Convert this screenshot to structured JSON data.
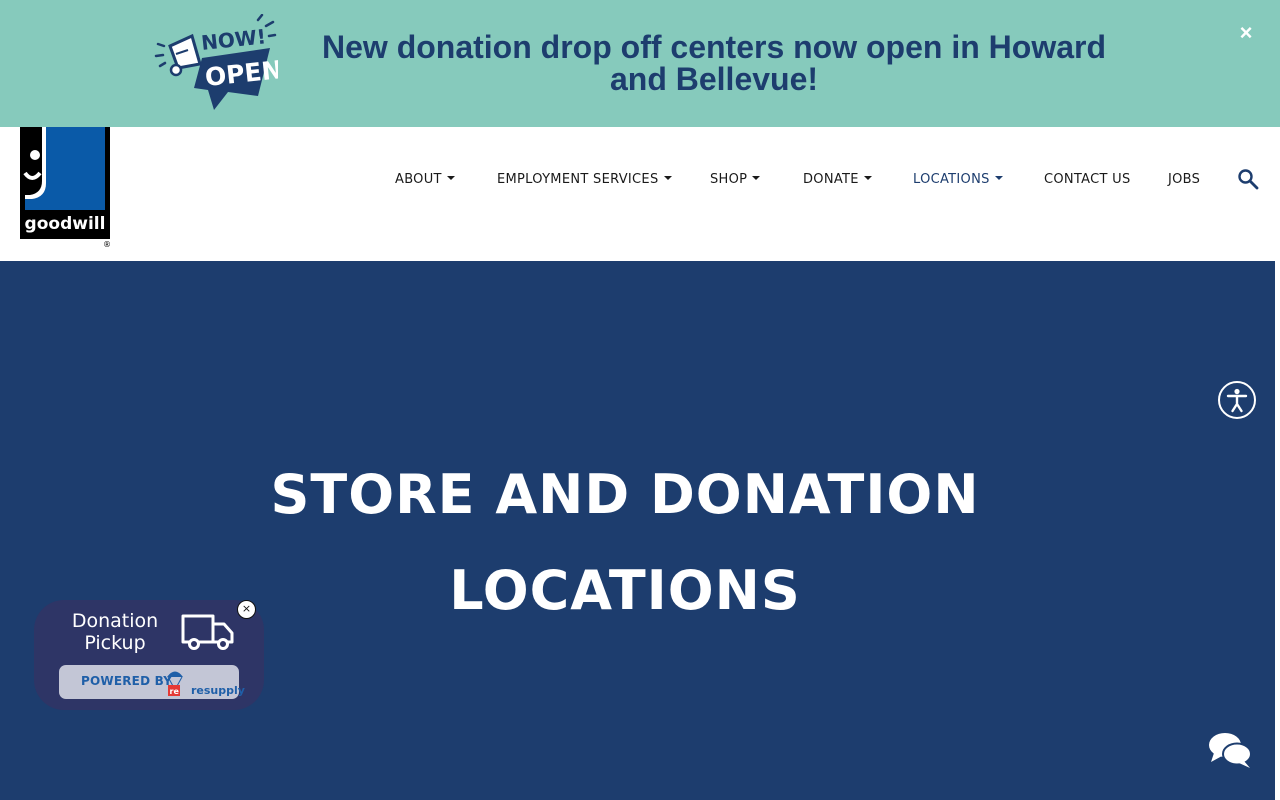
{
  "banner": {
    "badge_top": "NOW!",
    "badge_bottom": "OPEN",
    "text": "New donation drop off centers now open in Howard and Bellevue!",
    "close": "×"
  },
  "logo": {
    "text": "goodwill",
    "mark": "®"
  },
  "nav": {
    "items": [
      {
        "label": "ABOUT",
        "dropdown": true
      },
      {
        "label": "EMPLOYMENT SERVICES",
        "dropdown": true
      },
      {
        "label": "SHOP",
        "dropdown": true
      },
      {
        "label": "DONATE",
        "dropdown": true
      },
      {
        "label": "LOCATIONS",
        "dropdown": true,
        "active": true
      },
      {
        "label": "CONTACT US",
        "dropdown": false
      },
      {
        "label": "JOBS",
        "dropdown": false
      }
    ]
  },
  "hero": {
    "title": "STORE AND DONATION LOCATIONS"
  },
  "donation_widget": {
    "label": "Donation Pickup",
    "powered_by": "POWERED BY",
    "brand": "resupply",
    "close": "×"
  },
  "colors": {
    "banner_bg": "#86cabc",
    "brand_navy": "#1d3d6e",
    "goodwill_blue": "#0a5aa8",
    "widget_bg": "#2e3566"
  }
}
